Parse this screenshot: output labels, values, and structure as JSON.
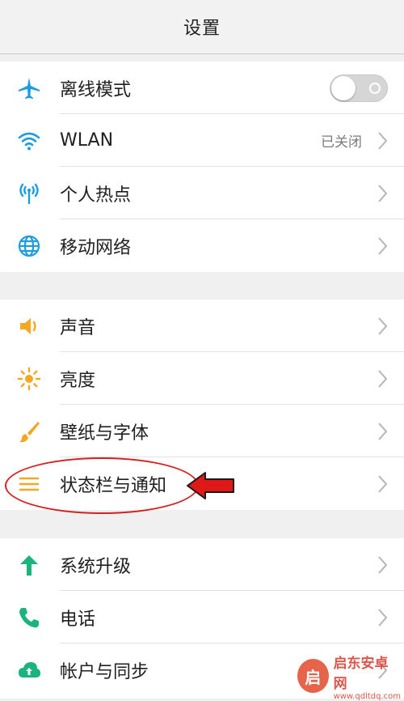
{
  "header": {
    "title": "设置"
  },
  "sections": [
    {
      "items": [
        {
          "label": "离线模式",
          "icon": "airplane-icon",
          "control": "toggle",
          "toggle_on": false
        },
        {
          "label": "WLAN",
          "icon": "wifi-icon",
          "value": "已关闭"
        },
        {
          "label": "个人热点",
          "icon": "hotspot-icon"
        },
        {
          "label": "移动网络",
          "icon": "globe-icon"
        }
      ]
    },
    {
      "items": [
        {
          "label": "声音",
          "icon": "speaker-icon"
        },
        {
          "label": "亮度",
          "icon": "sun-icon"
        },
        {
          "label": "壁纸与字体",
          "icon": "brush-icon"
        },
        {
          "label": "状态栏与通知",
          "icon": "menu-lines-icon"
        }
      ]
    },
    {
      "items": [
        {
          "label": "系统升级",
          "icon": "up-arrow-icon"
        },
        {
          "label": "电话",
          "icon": "phone-icon"
        },
        {
          "label": "帐户与同步",
          "icon": "cloud-sync-icon"
        }
      ]
    }
  ],
  "colors": {
    "blue": "#1f9be0",
    "orange": "#f5a623",
    "green": "#1bb37e",
    "annotation_red": "#d42020"
  },
  "watermark": {
    "brand": "启东安卓网",
    "url": "www.qdltdq.com",
    "logo_char": "启"
  }
}
